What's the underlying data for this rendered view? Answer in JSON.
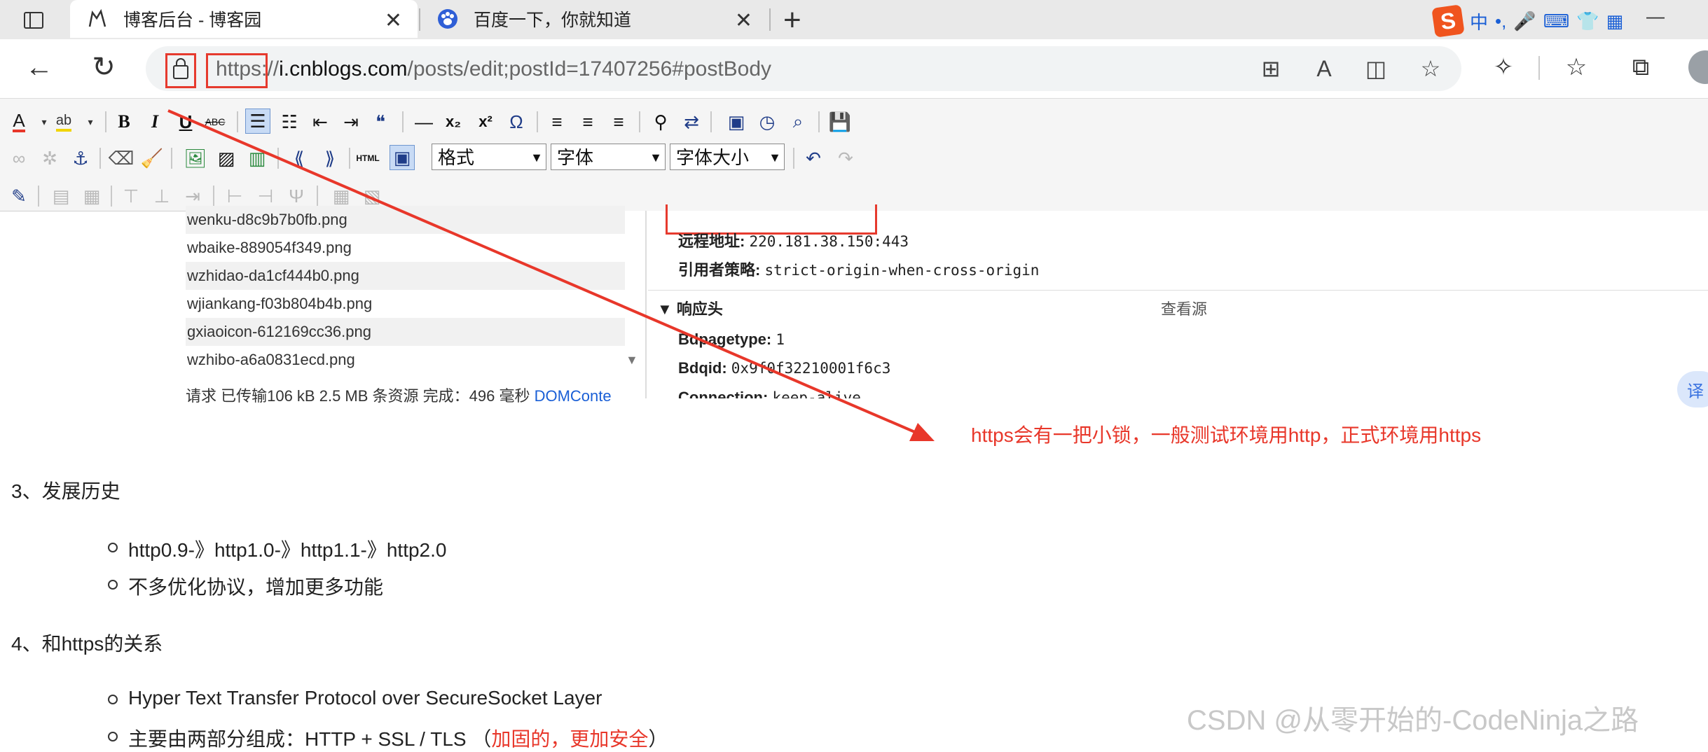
{
  "tabs": [
    {
      "title": "博客后台 - 博客园",
      "active": true,
      "icon": "cnblogs-icon"
    },
    {
      "title": "百度一下，你就知道",
      "active": false,
      "icon": "baidu-paw-icon"
    }
  ],
  "ime": {
    "mode": "中",
    "punct": "•,"
  },
  "address": {
    "scheme": "https",
    "separator": "://",
    "host": "i.cnblogs.com",
    "path": "/posts/edit;postId=17407256#postBody"
  },
  "editor_toolbar": {
    "format_label": "格式",
    "font_label": "字体",
    "size_label": "字体大小"
  },
  "devtools": {
    "files": [
      "wenku-d8c9b7b0fb.png",
      "wbaike-889054f349.png",
      "wzhidao-da1cf444b0.png",
      "wjiankang-f03b804b4b.png",
      "gxiaoicon-612169cc36.png",
      "wzhibo-a6a0831ecd.png"
    ],
    "status_text": "请求  已传输106 kB  2.5 MB 条资源  完成：496  毫秒  ",
    "status_link": "DOMConte",
    "remote_label": "远程地址:",
    "remote_value": "220.181.38.150:443",
    "referrer_label": "引用者策略:",
    "referrer_value": "strict-origin-when-cross-origin",
    "response_headers_title": "▼ 响应头",
    "view_source": "查看源",
    "bdpagetype_label": "Bdpagetype:",
    "bdpagetype_value": "1",
    "bdqid_label": "Bdqid:",
    "bdqid_value": "0x9f0f32210001f6c3",
    "connection_label": "Connection:",
    "connection_value": "keep-alive",
    "translate": "译"
  },
  "annotation": "https会有一把小锁，一般测试环境用http，正式环境用https",
  "article": {
    "section3_title": "3、发展历史",
    "section3_items": [
      "http0.9-》http1.0-》http1.1-》http2.0",
      "不多优化协议，增加更多功能"
    ],
    "section4_title": "4、和https的关系",
    "section4_item1": "Hyper Text Transfer Protocol over SecureSocket Layer",
    "section4_item2_prefix": "主要由两部分组成：HTTP + SSL / TLS  （",
    "section4_item2_red": "加固的，更加安全",
    "section4_item2_suffix": "）"
  },
  "watermark": "CSDN @从零开始的-CodeNinja之路",
  "colors": {
    "annotation_red": "#e8372a",
    "link_blue": "#1a5fd6",
    "ime_orange": "#f0541e"
  }
}
